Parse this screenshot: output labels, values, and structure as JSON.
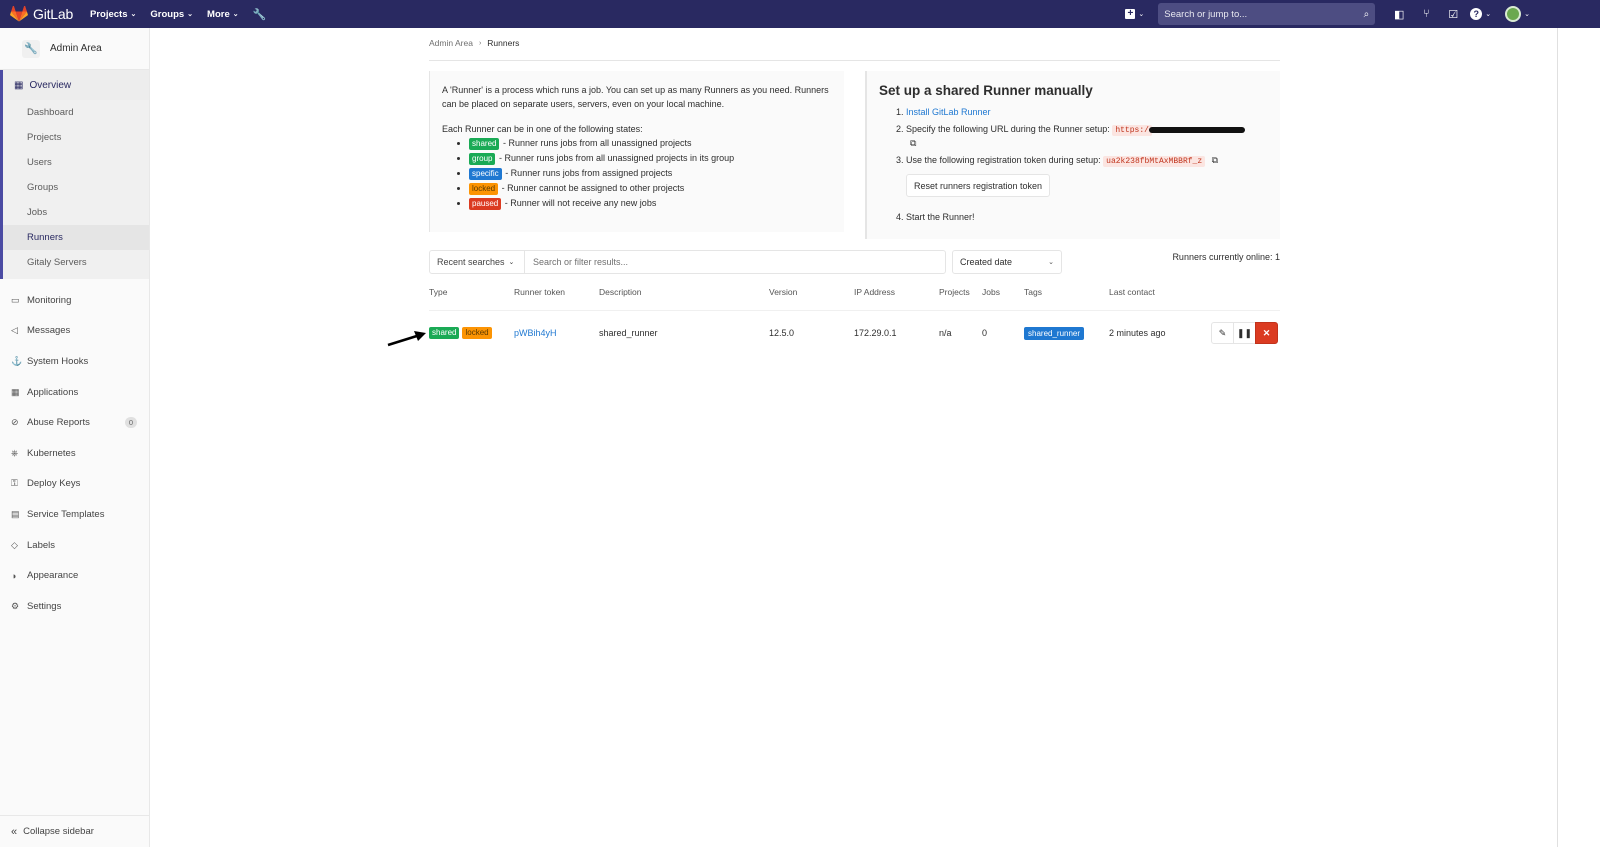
{
  "nav": {
    "logo_text": "GitLab",
    "links": [
      "Projects",
      "Groups",
      "More"
    ],
    "search_placeholder": "Search or jump to..."
  },
  "sidebar": {
    "title": "Admin Area",
    "overview": "Overview",
    "subitems": [
      "Dashboard",
      "Projects",
      "Users",
      "Groups",
      "Jobs",
      "Runners",
      "Gitaly Servers"
    ],
    "active_subitem": "Runners",
    "items": [
      {
        "label": "Monitoring",
        "icon": "monitor-icon"
      },
      {
        "label": "Messages",
        "icon": "bullhorn-icon"
      },
      {
        "label": "System Hooks",
        "icon": "hook-icon"
      },
      {
        "label": "Applications",
        "icon": "applications-icon"
      },
      {
        "label": "Abuse Reports",
        "icon": "abuse-icon",
        "badge": "0"
      },
      {
        "label": "Kubernetes",
        "icon": "kubernetes-icon"
      },
      {
        "label": "Deploy Keys",
        "icon": "key-icon"
      },
      {
        "label": "Service Templates",
        "icon": "template-icon"
      },
      {
        "label": "Labels",
        "icon": "label-icon"
      },
      {
        "label": "Appearance",
        "icon": "appearance-icon"
      },
      {
        "label": "Settings",
        "icon": "settings-icon"
      }
    ],
    "collapse": "Collapse sidebar"
  },
  "breadcrumb": {
    "parent": "Admin Area",
    "current": "Runners"
  },
  "info": {
    "intro": "A 'Runner' is a process which runs a job. You can set up as many Runners as you need. Runners can be placed on separate users, servers, even on your local machine.",
    "states_intro": "Each Runner can be in one of the following states:",
    "states": [
      {
        "badge": "shared",
        "text": " - Runner runs jobs from all unassigned projects"
      },
      {
        "badge": "group",
        "text": " - Runner runs jobs from all unassigned projects in its group"
      },
      {
        "badge": "specific",
        "text": " - Runner runs jobs from assigned projects"
      },
      {
        "badge": "locked",
        "text": " - Runner cannot be assigned to other projects"
      },
      {
        "badge": "paused",
        "text": " - Runner will not receive any new jobs"
      }
    ]
  },
  "setup": {
    "title": "Set up a shared Runner manually",
    "step1_link": "Install GitLab Runner",
    "step2_text": "Specify the following URL during the Runner setup:",
    "step2_url": "https:/",
    "step3_text": "Use the following registration token during setup:",
    "token": "ua2k238fbMtAxMBBRf_z",
    "reset_button": "Reset runners registration token",
    "step4_text": "Start the Runner!"
  },
  "filter": {
    "recent": "Recent searches",
    "placeholder": "Search or filter results...",
    "sort": "Created date",
    "online": "Runners currently online: 1"
  },
  "table": {
    "headers": [
      "Type",
      "Runner token",
      "Description",
      "Version",
      "IP Address",
      "Projects",
      "Jobs",
      "Tags",
      "Last contact"
    ],
    "rows": [
      {
        "types": [
          "shared",
          "locked"
        ],
        "token": "pWBih4yH",
        "description": "shared_runner",
        "version": "12.5.0",
        "ip": "172.29.0.1",
        "projects": "n/a",
        "jobs": "0",
        "tag": "shared_runner",
        "last_contact": "2 minutes ago"
      }
    ]
  },
  "colors": {
    "nav_bg": "#292961",
    "green": "#1aaa55",
    "blue": "#1f78d1",
    "orange": "#fc9403",
    "red": "#db3b21"
  }
}
